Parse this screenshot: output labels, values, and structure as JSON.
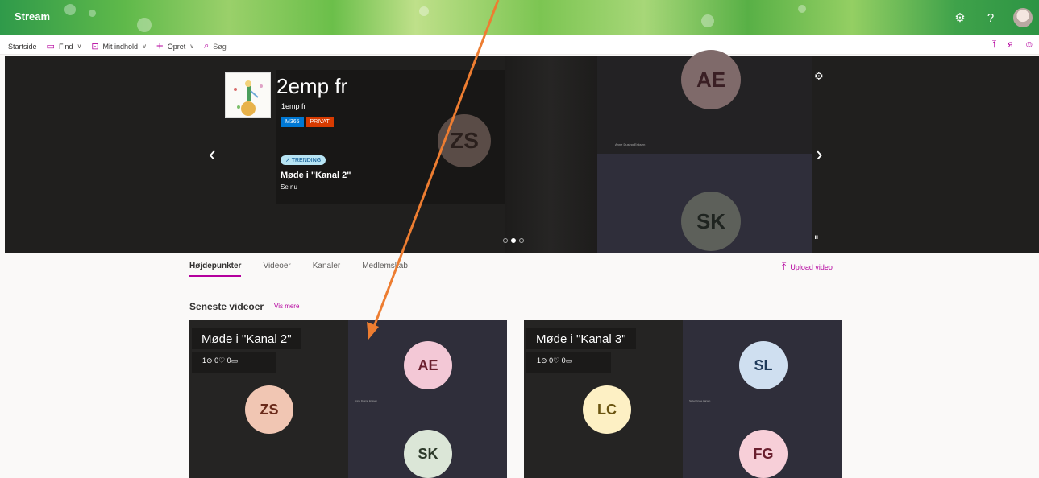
{
  "app": {
    "name": "Stream"
  },
  "top_icons": [
    "gear-icon",
    "help-icon"
  ],
  "nav": {
    "items": [
      {
        "label": "Startside",
        "icon": "",
        "chevron": false
      },
      {
        "label": "Find",
        "icon": "find-icon",
        "chevron": true
      },
      {
        "label": "Mit indhold",
        "icon": "content-icon",
        "chevron": true
      },
      {
        "label": "Opret",
        "icon": "plus-icon",
        "chevron": true
      },
      {
        "label": "Søg",
        "icon": "search-icon",
        "chevron": false
      }
    ],
    "right_icons": [
      "upload-icon",
      "people-icon",
      "smiley-icon"
    ]
  },
  "hero": {
    "title": "2emp fr",
    "subtitle": "1emp fr",
    "badges": [
      "M365",
      "PRIVAT"
    ],
    "trending_label": "TRENDING",
    "video_title": "Møde i \"Kanal 2\"",
    "video_action": "Se nu",
    "avatars": [
      "ZS",
      "AE",
      "SK"
    ],
    "participant_name": "Anne Dusing Eriksen",
    "dots": 3,
    "active_dot": 1
  },
  "tabs": [
    {
      "label": "Højdepunkter",
      "active": true
    },
    {
      "label": "Videoer",
      "active": false
    },
    {
      "label": "Kanaler",
      "active": false
    },
    {
      "label": "Medlemskab",
      "active": false
    }
  ],
  "upload_label": "Upload video",
  "section": {
    "title": "Seneste videoer",
    "more_label": "Vis mere"
  },
  "videos": [
    {
      "title": "Møde i \"Kanal 2\"",
      "views": "1",
      "likes": "0",
      "comments": "0",
      "avatars": [
        "ZS",
        "AE",
        "SK"
      ],
      "participant_name": "Anne Dusing Eriksen"
    },
    {
      "title": "Møde i \"Kanal 3\"",
      "views": "1",
      "likes": "0",
      "comments": "0",
      "avatars": [
        "LC",
        "SL",
        "FG"
      ],
      "participant_name": "Sabel Kruse Larsen"
    }
  ],
  "colors": {
    "accent": "#b4009e",
    "arrow": "#ed7d31",
    "m365": "#0078d4",
    "privat": "#d83b01"
  }
}
